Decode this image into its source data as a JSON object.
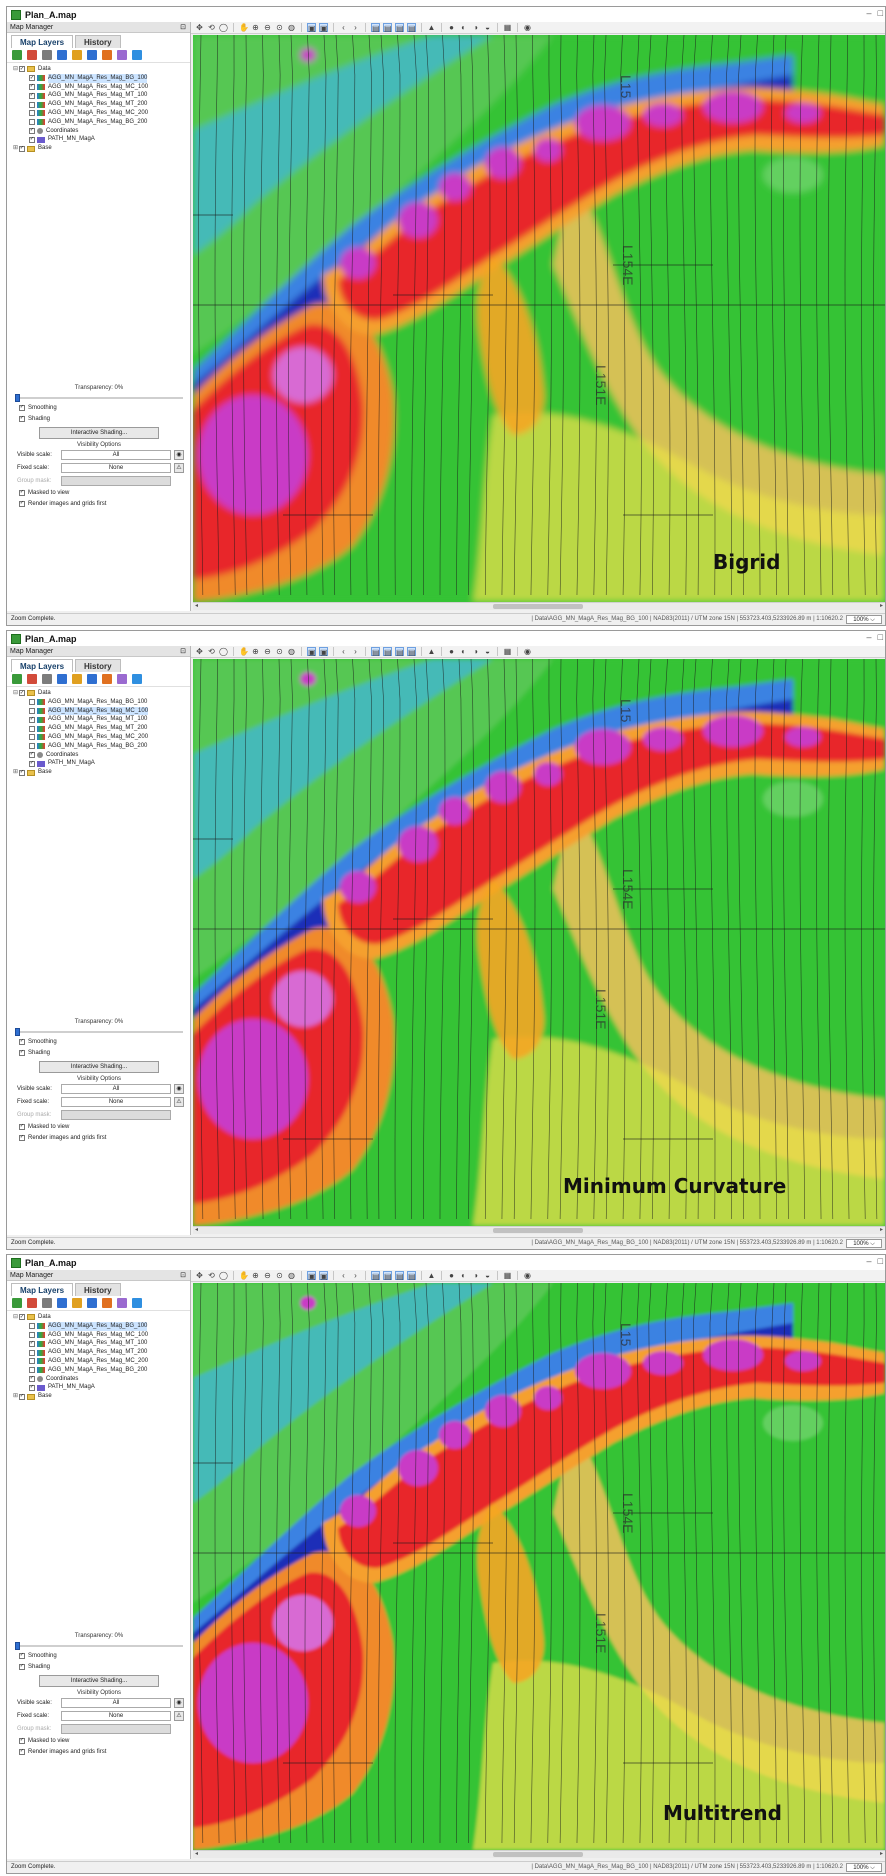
{
  "window": {
    "title": "Plan_A.map",
    "controls": [
      "–",
      "□"
    ]
  },
  "map_manager": {
    "header": "Map Manager",
    "pin": "⊡",
    "tabs": [
      {
        "label": "Map Layers",
        "active": true
      },
      {
        "label": "History",
        "active": false
      }
    ],
    "toolbar_icons": [
      "add-layer-icon",
      "remove-layer-icon",
      "list-icon",
      "properties-icon",
      "color-icon",
      "shade-icon",
      "globe-icon",
      "arrow-icon",
      "help-icon"
    ]
  },
  "layers": [
    {
      "label": "Data",
      "indent": 0,
      "type": "folder",
      "expander": "⊟"
    },
    {
      "label": "AGG_MN_MagA_Res_Mag_BG_100",
      "indent": 1,
      "type": "grid"
    },
    {
      "label": "AGG_MN_MagA_Res_Mag_MC_100",
      "indent": 1,
      "type": "grid"
    },
    {
      "label": "AGG_MN_MagA_Res_Mag_MT_100",
      "indent": 1,
      "type": "grid"
    },
    {
      "label": "AGG_MN_MagA_Res_Mag_MT_200",
      "indent": 1,
      "type": "grid"
    },
    {
      "label": "AGG_MN_MagA_Res_Mag_MC_200",
      "indent": 1,
      "type": "grid"
    },
    {
      "label": "AGG_MN_MagA_Res_Mag_BG_200",
      "indent": 1,
      "type": "grid"
    },
    {
      "label": "Coordinates",
      "indent": 1,
      "type": "coord"
    },
    {
      "label": "PATH_MN_MagA",
      "indent": 1,
      "type": "path"
    },
    {
      "label": "Base",
      "indent": 0,
      "type": "folder",
      "expander": "⊞"
    }
  ],
  "options": {
    "transparency_label": "Transparency: 0%",
    "transparency_value": 0,
    "smoothing_label": "Smoothing",
    "shading_label": "Shading",
    "shading_button": "Interactive Shading...",
    "visibility_title": "Visibility Options",
    "visible_scale_label": "Visible scale:",
    "visible_scale_value": "All",
    "fixed_scale_label": "Fixed scale:",
    "fixed_scale_value": "None",
    "group_mask_label": "Group mask:",
    "masked_label": "Masked to view",
    "render_label": "Render images and grids first"
  },
  "status": {
    "left": "Zoom Complete.",
    "right": "| Data\\AGG_MN_MagA_Res_Mag_BG_100 | NAD83(2011) / UTM zone 15N | 553723.403,5233926.89 m | 1:10620.2",
    "zoom": "100% ⌵"
  },
  "map_labels": {
    "line_a": "L151E",
    "line_b": "L154E",
    "line_c": "L15"
  },
  "panels": [
    {
      "method": "Bigrid",
      "checked": [
        true,
        true,
        true,
        false,
        false,
        false,
        true,
        true
      ],
      "selected": 0
    },
    {
      "method": "Minimum Curvature",
      "checked": [
        false,
        false,
        true,
        false,
        false,
        false,
        true,
        true
      ],
      "selected": 1
    },
    {
      "method": "Multitrend",
      "checked": [
        false,
        false,
        true,
        false,
        false,
        false,
        true,
        true
      ],
      "selected": 0
    }
  ],
  "colors": {
    "map_green": "#34c334",
    "map_blue": "#1a2fb8",
    "map_red": "#e8252a",
    "map_magenta": "#c93ac6",
    "map_orange": "#f5a623",
    "map_yellow": "#e8df4a",
    "map_cyan": "#3fb5d9"
  }
}
